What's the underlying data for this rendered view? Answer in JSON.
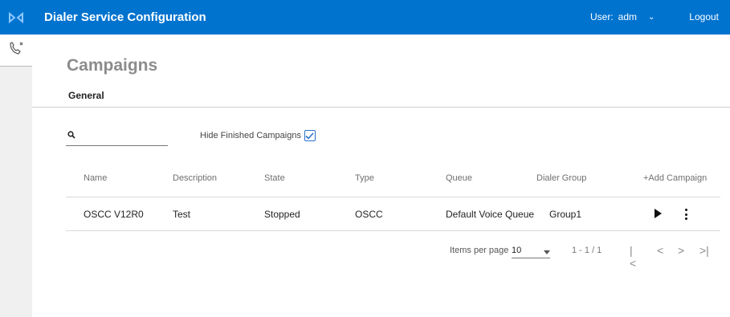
{
  "header": {
    "title": "Dialer Service Configuration",
    "user_label": "User:",
    "user_name": "adm",
    "logout_label": "Logout"
  },
  "page": {
    "title": "Campaigns",
    "tab_general": "General"
  },
  "filters": {
    "search_placeholder": "",
    "hide_finished_label": "Hide Finished Campaigns",
    "hide_finished_checked": true
  },
  "table": {
    "columns": [
      "Name",
      "Description",
      "State",
      "Type",
      "Queue",
      "Dialer Group"
    ],
    "add_campaign_label": "+Add Campaign",
    "rows": [
      {
        "name": "OSCC V12R0",
        "description": "Test",
        "state": "Stopped",
        "type": "OSCC",
        "queue": "Default Voice Queue",
        "dialer_group": "Group1"
      }
    ]
  },
  "pagination": {
    "items_per_page_label": "Items per page",
    "items_per_page": "10",
    "range": "1 - 1 / 1"
  },
  "colors": {
    "header_bg": "#0073cf",
    "accent": "#2a72c9"
  },
  "icons": {
    "logo": "brand-logo-icon",
    "nav": "phone-user-icon",
    "search": "search-icon",
    "play": "play-icon",
    "more": "more-vertical-icon"
  }
}
